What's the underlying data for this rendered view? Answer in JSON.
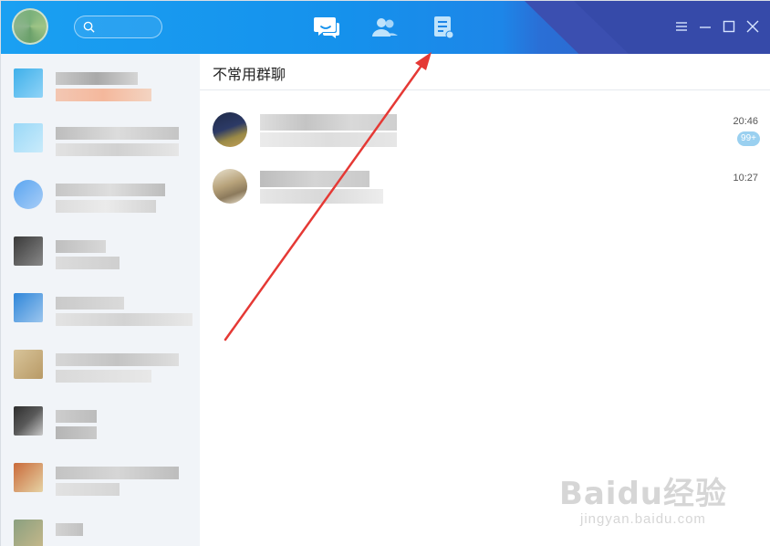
{
  "titlebar": {
    "icons": [
      "chat-icon",
      "contacts-icon",
      "notes-icon"
    ],
    "controls": [
      "menu-icon",
      "minimize-icon",
      "maximize-icon",
      "close-icon"
    ],
    "colors": {
      "primary": "#1591ec",
      "accent": "#3449a6"
    }
  },
  "main": {
    "header": {
      "title": "不常用群聊"
    },
    "groups": [
      {
        "time": "20:46",
        "badge": "99+"
      },
      {
        "time": "10:27",
        "badge": ""
      }
    ]
  },
  "watermark": {
    "brand": "Baidu经验",
    "url": "jingyan.baidu.com"
  },
  "annotation": {
    "arrow_color": "#e53935"
  }
}
